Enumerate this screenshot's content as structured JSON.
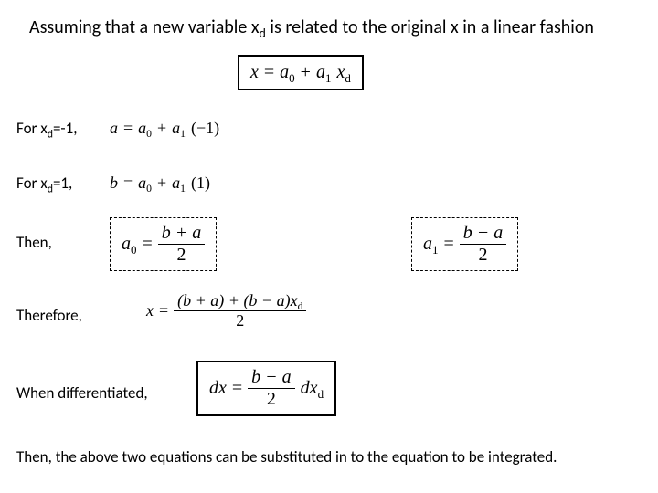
{
  "intro": "Assuming that a new variable xₓ is related to the original x in a linear fashion",
  "intro_sub_var": "d",
  "for_neg": {
    "lead_pre": "For x",
    "lead_sub": "d",
    "lead_post": "=-1,"
  },
  "for_pos": {
    "lead_pre": "For x",
    "lead_sub": "d",
    "lead_post": "=1,"
  },
  "then": "Then,",
  "therefore": "Therefore,",
  "when_diff": "When differentiated,",
  "final": "Then, the above two equations can be substituted in to the equation to be integrated.",
  "eq": {
    "main": {
      "lhs": "x",
      "eq": "=",
      "rhs_a": "a",
      "rhs_a_sub": "0",
      "plus": "+",
      "rhs_b": "a",
      "rhs_b_sub": "1",
      "xd": "x",
      "xd_sub": "d"
    },
    "case_neg": {
      "lhs": "a",
      "eq": "=",
      "a0": "a",
      "a0_sub": "0",
      "plus": "+",
      "a1": "a",
      "a1_sub": "1",
      "paren": "(−1)"
    },
    "case_pos": {
      "lhs": "b",
      "eq": "=",
      "a0": "a",
      "a0_sub": "0",
      "plus": "+",
      "a1": "a",
      "a1_sub": "1",
      "paren": "(1)"
    },
    "a0": {
      "lhs": "a",
      "lhs_sub": "0",
      "eq": "=",
      "num": "b + a",
      "den": "2"
    },
    "a1": {
      "lhs": "a",
      "lhs_sub": "1",
      "eq": "=",
      "num": "b − a",
      "den": "2"
    },
    "x_expand": {
      "lhs": "x",
      "eq": "=",
      "num_pre": "(b + a) + (b − a)x",
      "num_sub": "d",
      "den": "2"
    },
    "dx": {
      "lhs": "dx",
      "eq": "=",
      "num": "b − a",
      "den": "2",
      "tail": "dx",
      "tail_sub": "d"
    }
  }
}
